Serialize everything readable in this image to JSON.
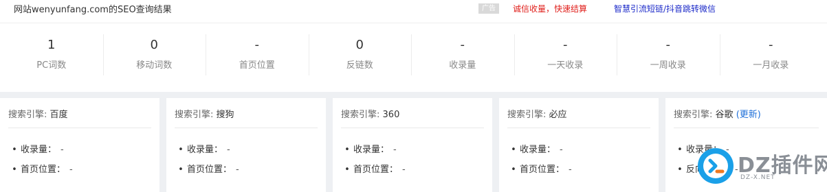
{
  "header": {
    "title": "网站wenyunfang.com的SEO查询结果",
    "ad_badge": "广告",
    "ad_link_1": "诚信收量，快速结算",
    "ad_link_2": "智慧引流短链/抖音跳转微信"
  },
  "stats": [
    {
      "value": "1",
      "label": "PC词数"
    },
    {
      "value": "0",
      "label": "移动词数"
    },
    {
      "value": "-",
      "label": "首页位置"
    },
    {
      "value": "0",
      "label": "反链数"
    },
    {
      "value": "-",
      "label": "收录量"
    },
    {
      "value": "-",
      "label": "一天收录"
    },
    {
      "value": "-",
      "label": "一周收录"
    },
    {
      "value": "-",
      "label": "一月收录"
    }
  ],
  "engines": [
    {
      "label": "搜索引擎:",
      "name": "百度",
      "rows": [
        {
          "label": "收录量：",
          "value": "-"
        },
        {
          "label": "首页位置：",
          "value": "-"
        }
      ]
    },
    {
      "label": "搜索引擎:",
      "name": "搜狗",
      "rows": [
        {
          "label": "收录量：",
          "value": "-"
        },
        {
          "label": "首页位置：",
          "value": "-"
        }
      ]
    },
    {
      "label": "搜索引擎:",
      "name": "360",
      "rows": [
        {
          "label": "收录量：",
          "value": "-"
        },
        {
          "label": "首页位置：",
          "value": "-"
        }
      ]
    },
    {
      "label": "搜索引擎:",
      "name": "必应",
      "rows": [
        {
          "label": "收录量：",
          "value": "-"
        },
        {
          "label": "首页位置：",
          "value": "-"
        }
      ]
    },
    {
      "label": "搜索引擎:",
      "name": "谷歌",
      "link": "(更新)",
      "rows": [
        {
          "label": "收录量：",
          "value": "-"
        },
        {
          "label": "反向链接：",
          "value": "-"
        }
      ]
    }
  ],
  "bullet": "•",
  "watermark": {
    "text": "DZ插件网",
    "sub": "DZ-X.NET"
  },
  "colors": {
    "accent_link": "#1e6fd9",
    "ad_red": "#e0201c",
    "ad_blue": "#1a28c8"
  }
}
